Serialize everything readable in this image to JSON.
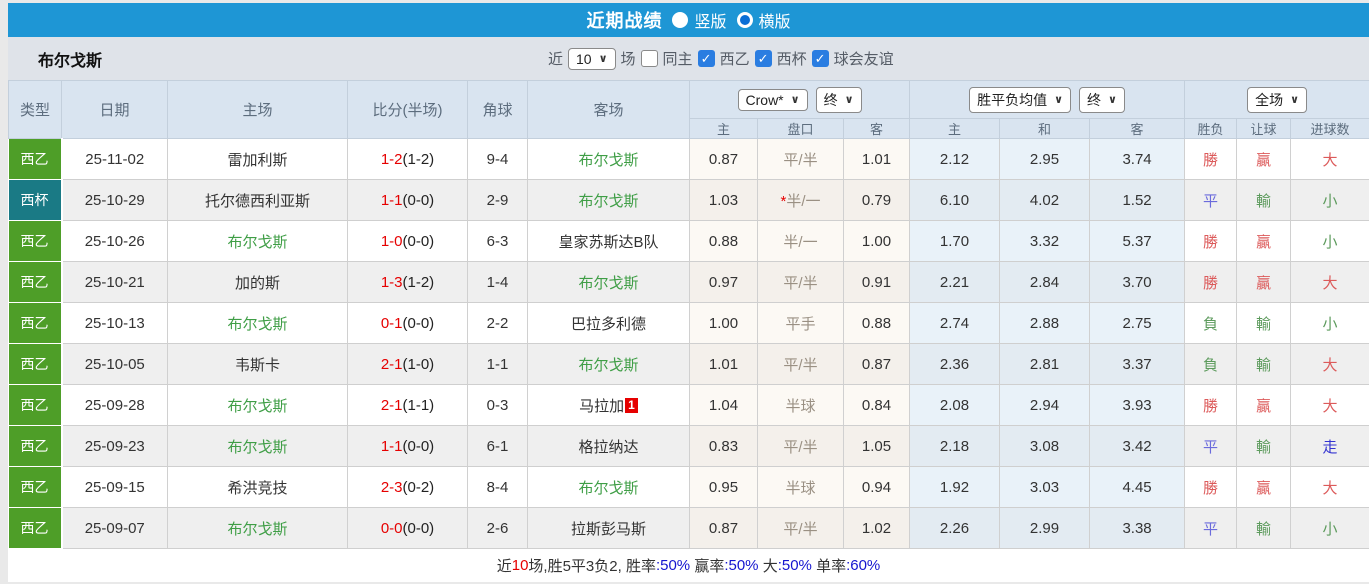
{
  "topbar": {
    "title": "近期战绩",
    "radio_vertical": "竖版",
    "radio_horizontal": "横版"
  },
  "filter": {
    "team": "布尔戈斯",
    "near_label": "近",
    "near_value": "10",
    "games_label": "场",
    "same_home_label": "同主",
    "checkboxes": [
      {
        "label": "西乙",
        "checked": true
      },
      {
        "label": "西杯",
        "checked": true
      },
      {
        "label": "球会友谊",
        "checked": true
      }
    ]
  },
  "table": {
    "left_headers": [
      "类型",
      "日期",
      "主场",
      "比分(半场)",
      "角球",
      "客场"
    ],
    "selects": {
      "crow": "Crow*",
      "crow_period": "终",
      "avg": "胜平负均值",
      "avg_period": "终",
      "full": "全场"
    },
    "sub_headers": [
      "主",
      "盘口",
      "客",
      "主",
      "和",
      "客",
      "胜负",
      "让球",
      "进球数"
    ],
    "rows": [
      {
        "type": "西乙",
        "type_style": "league",
        "date": "25-11-02",
        "home": "雷加利斯",
        "home_hl": false,
        "score": "1-2",
        "half": "(1-2)",
        "corner": "9-4",
        "away": "布尔戈斯",
        "away_hl": true,
        "away_badge": "",
        "crow_home": "0.87",
        "handicap_star": false,
        "handicap": "平/半",
        "crow_away": "1.01",
        "avg_home": "2.12",
        "avg_draw": "2.95",
        "avg_away": "3.74",
        "wdl": "勝",
        "wdl_c": "red",
        "let": "贏",
        "let_c": "red",
        "goal": "大",
        "goal_c": "red"
      },
      {
        "type": "西杯",
        "type_style": "cup",
        "date": "25-10-29",
        "home": "托尔德西利亚斯",
        "home_hl": false,
        "score": "1-1",
        "half": "(0-0)",
        "corner": "2-9",
        "away": "布尔戈斯",
        "away_hl": true,
        "away_badge": "",
        "crow_home": "1.03",
        "handicap_star": true,
        "handicap": "半/一",
        "crow_away": "0.79",
        "avg_home": "6.10",
        "avg_draw": "4.02",
        "avg_away": "1.52",
        "wdl": "平",
        "wdl_c": "blue",
        "let": "輸",
        "let_c": "green",
        "goal": "小",
        "goal_c": "green"
      },
      {
        "type": "西乙",
        "type_style": "league",
        "date": "25-10-26",
        "home": "布尔戈斯",
        "home_hl": true,
        "score": "1-0",
        "half": "(0-0)",
        "corner": "6-3",
        "away": "皇家苏斯达B队",
        "away_hl": false,
        "away_badge": "",
        "crow_home": "0.88",
        "handicap_star": false,
        "handicap": "半/一",
        "crow_away": "1.00",
        "avg_home": "1.70",
        "avg_draw": "3.32",
        "avg_away": "5.37",
        "wdl": "勝",
        "wdl_c": "red",
        "let": "贏",
        "let_c": "red",
        "goal": "小",
        "goal_c": "green"
      },
      {
        "type": "西乙",
        "type_style": "league",
        "date": "25-10-21",
        "home": "加的斯",
        "home_hl": false,
        "score": "1-3",
        "half": "(1-2)",
        "corner": "1-4",
        "away": "布尔戈斯",
        "away_hl": true,
        "away_badge": "",
        "crow_home": "0.97",
        "handicap_star": false,
        "handicap": "平/半",
        "crow_away": "0.91",
        "avg_home": "2.21",
        "avg_draw": "2.84",
        "avg_away": "3.70",
        "wdl": "勝",
        "wdl_c": "red",
        "let": "贏",
        "let_c": "red",
        "goal": "大",
        "goal_c": "red"
      },
      {
        "type": "西乙",
        "type_style": "league",
        "date": "25-10-13",
        "home": "布尔戈斯",
        "home_hl": true,
        "score": "0-1",
        "half": "(0-0)",
        "corner": "2-2",
        "away": "巴拉多利德",
        "away_hl": false,
        "away_badge": "",
        "crow_home": "1.00",
        "handicap_star": false,
        "handicap": "平手",
        "crow_away": "0.88",
        "avg_home": "2.74",
        "avg_draw": "2.88",
        "avg_away": "2.75",
        "wdl": "負",
        "wdl_c": "green",
        "let": "輸",
        "let_c": "green",
        "goal": "小",
        "goal_c": "green"
      },
      {
        "type": "西乙",
        "type_style": "league",
        "date": "25-10-05",
        "home": "韦斯卡",
        "home_hl": false,
        "score": "2-1",
        "half": "(1-0)",
        "corner": "1-1",
        "away": "布尔戈斯",
        "away_hl": true,
        "away_badge": "",
        "crow_home": "1.01",
        "handicap_star": false,
        "handicap": "平/半",
        "crow_away": "0.87",
        "avg_home": "2.36",
        "avg_draw": "2.81",
        "avg_away": "3.37",
        "wdl": "負",
        "wdl_c": "green",
        "let": "輸",
        "let_c": "green",
        "goal": "大",
        "goal_c": "red"
      },
      {
        "type": "西乙",
        "type_style": "league",
        "date": "25-09-28",
        "home": "布尔戈斯",
        "home_hl": true,
        "score": "2-1",
        "half": "(1-1)",
        "corner": "0-3",
        "away": "马拉加",
        "away_hl": false,
        "away_badge": "1",
        "crow_home": "1.04",
        "handicap_star": false,
        "handicap": "半球",
        "crow_away": "0.84",
        "avg_home": "2.08",
        "avg_draw": "2.94",
        "avg_away": "3.93",
        "wdl": "勝",
        "wdl_c": "red",
        "let": "贏",
        "let_c": "red",
        "goal": "大",
        "goal_c": "red"
      },
      {
        "type": "西乙",
        "type_style": "league",
        "date": "25-09-23",
        "home": "布尔戈斯",
        "home_hl": true,
        "score": "1-1",
        "half": "(0-0)",
        "corner": "6-1",
        "away": "格拉纳达",
        "away_hl": false,
        "away_badge": "",
        "crow_home": "0.83",
        "handicap_star": false,
        "handicap": "平/半",
        "crow_away": "1.05",
        "avg_home": "2.18",
        "avg_draw": "3.08",
        "avg_away": "3.42",
        "wdl": "平",
        "wdl_c": "blue",
        "let": "輸",
        "let_c": "green",
        "goal": "走",
        "goal_c": "walk"
      },
      {
        "type": "西乙",
        "type_style": "league",
        "date": "25-09-15",
        "home": "希洪竞技",
        "home_hl": false,
        "score": "2-3",
        "half": "(0-2)",
        "corner": "8-4",
        "away": "布尔戈斯",
        "away_hl": true,
        "away_badge": "",
        "crow_home": "0.95",
        "handicap_star": false,
        "handicap": "半球",
        "crow_away": "0.94",
        "avg_home": "1.92",
        "avg_draw": "3.03",
        "avg_away": "4.45",
        "wdl": "勝",
        "wdl_c": "red",
        "let": "贏",
        "let_c": "red",
        "goal": "大",
        "goal_c": "red"
      },
      {
        "type": "西乙",
        "type_style": "league",
        "date": "25-09-07",
        "home": "布尔戈斯",
        "home_hl": true,
        "score": "0-0",
        "half": "(0-0)",
        "corner": "2-6",
        "away": "拉斯彭马斯",
        "away_hl": false,
        "away_badge": "",
        "crow_home": "0.87",
        "handicap_star": false,
        "handicap": "平/半",
        "crow_away": "1.02",
        "avg_home": "2.26",
        "avg_draw": "2.99",
        "avg_away": "3.38",
        "wdl": "平",
        "wdl_c": "blue",
        "let": "輸",
        "let_c": "green",
        "goal": "小",
        "goal_c": "green"
      }
    ]
  },
  "summary": {
    "segments": [
      {
        "t": "近",
        "c": "dark"
      },
      {
        "t": "10",
        "c": "red"
      },
      {
        "t": "场,胜5平3负2, 胜率",
        "c": "dark"
      },
      {
        "t": ":50%",
        "c": "blue"
      },
      {
        "t": " 赢率",
        "c": "dark"
      },
      {
        "t": ":50%",
        "c": "blue"
      },
      {
        "t": " 大",
        "c": "dark"
      },
      {
        "t": ":50%",
        "c": "blue"
      },
      {
        "t": " 单率",
        "c": "dark"
      },
      {
        "t": ":60%",
        "c": "blue"
      }
    ]
  },
  "colors": {
    "topbar_blue": "#1e96d5",
    "league_green": "#4e9e28",
    "cup_teal": "#1a7a85",
    "team_green": "#3f9e46",
    "score_red": "#e60000",
    "handicap_gray": "#9a9083",
    "text_dark": "#333333",
    "result_red": "#dc5a5a",
    "result_blue": "#6b6bdc",
    "result_green": "#5d9b5d",
    "result_walk": "#3434d0",
    "summary_blue": "#1515cf",
    "summary_red": "#e60000"
  }
}
